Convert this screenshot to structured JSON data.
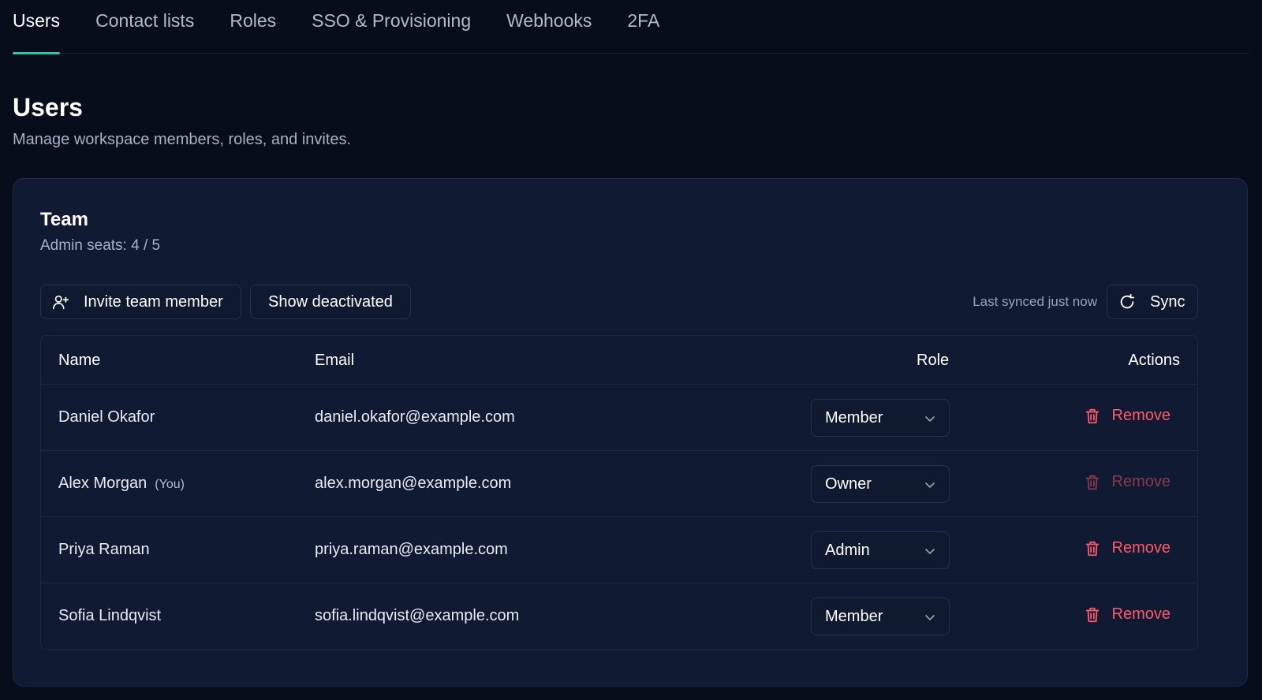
{
  "tabs": [
    {
      "label": "Users",
      "active": true
    },
    {
      "label": "Contact lists"
    },
    {
      "label": "Roles"
    },
    {
      "label": "SSO & Provisioning"
    },
    {
      "label": "Webhooks"
    },
    {
      "label": "2FA"
    }
  ],
  "page": {
    "title": "Users",
    "subtitle": "Manage workspace members, roles, and invites."
  },
  "team": {
    "title": "Team",
    "admin_seats": "Admin seats: 4 / 5",
    "invite_label": "Invite team member",
    "show_deactivated_label": "Show deactivated",
    "sync_status": "Last synced just now",
    "sync_label": "Sync"
  },
  "table": {
    "headers": {
      "name": "Name",
      "email": "Email",
      "role": "Role",
      "actions": "Actions"
    },
    "rows": [
      {
        "name": "Daniel Okafor",
        "you": "",
        "email": "daniel.okafor@example.com",
        "role": "Member",
        "action": "Remove"
      },
      {
        "name": "Alex Morgan",
        "you": "(You)",
        "email": "alex.morgan@example.com",
        "role": "Owner",
        "action": "Remove"
      },
      {
        "name": "Priya Raman",
        "you": "",
        "email": "priya.raman@example.com",
        "role": "Admin",
        "action": "Remove"
      },
      {
        "name": "Sofia Lindqvist",
        "you": "",
        "email": "sofia.lindqvist@example.com",
        "role": "Member",
        "action": "Remove"
      }
    ]
  },
  "icons": {
    "invite": "user-plus-icon",
    "sync": "refresh-icon",
    "role_select": "chevron-down-icon",
    "remove": "trash-icon"
  },
  "colors": {
    "accent": "#2ec4a6",
    "danger": "#ff5a6a",
    "background": "#080d1c",
    "card": "#101a33"
  }
}
